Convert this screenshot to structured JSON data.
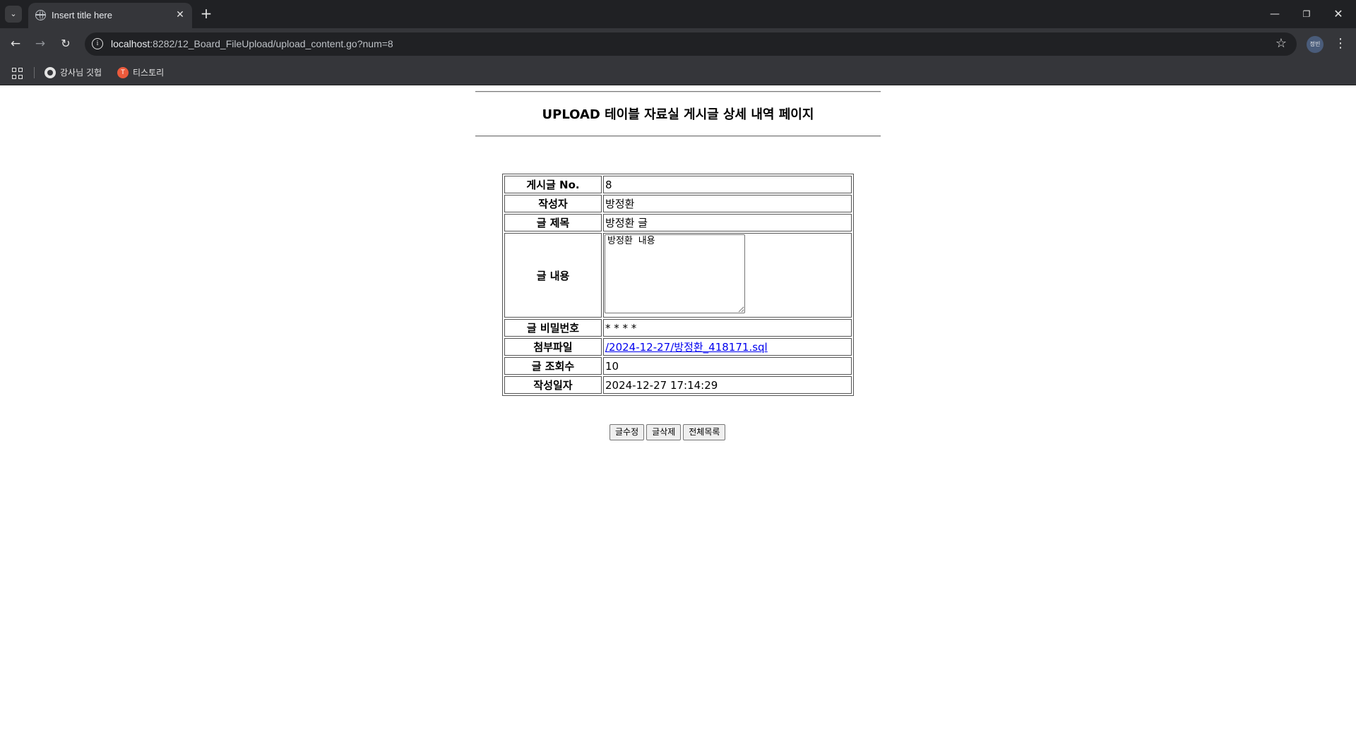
{
  "browser": {
    "tab_title": "Insert title here",
    "url_host": "localhost",
    "url_rest": ":8282/12_Board_FileUpload/upload_content.go?num=8",
    "profile_label": "정빈",
    "bookmarks": [
      {
        "label": "강사님 깃헙",
        "icon": "github-icon"
      },
      {
        "label": "티스토리",
        "icon": "tistory-icon"
      }
    ],
    "icons": {
      "tab_list": "⌄",
      "close": "✕",
      "new_tab": "+",
      "minimize": "—",
      "maximize": "❐",
      "win_close": "✕",
      "back": "←",
      "forward": "→",
      "reload": "↻",
      "info": "i",
      "star": "☆",
      "menu": "⋮",
      "tistory": "T"
    }
  },
  "page": {
    "title": "UPLOAD 테이블 자료실 게시글 상세 내역 페이지",
    "rows": {
      "no": {
        "label": "게시글 No.",
        "value": "8"
      },
      "writer": {
        "label": "작성자",
        "value": "방정환"
      },
      "subject": {
        "label": "글 제목",
        "value": "방정환 글"
      },
      "content": {
        "label": "글 내용",
        "value": "방정환 내용"
      },
      "password": {
        "label": "글 비밀번호",
        "value": "* * * *"
      },
      "file": {
        "label": "첨부파일",
        "value": "/2024-12-27/방정환_418171.sql"
      },
      "hit": {
        "label": "글 조회수",
        "value": "10"
      },
      "date": {
        "label": "작성일자",
        "value": "2024-12-27 17:14:29"
      }
    },
    "buttons": {
      "edit": "글수정",
      "delete": "글삭제",
      "list": "전체목록"
    }
  }
}
